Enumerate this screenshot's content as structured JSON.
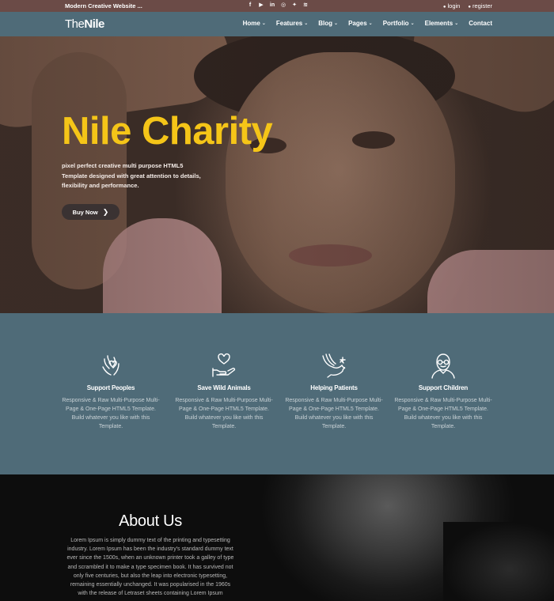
{
  "topbar": {
    "tagline": "Modern Creative Website ...",
    "socials": [
      {
        "icon": "facebook-icon",
        "glyph": "f"
      },
      {
        "icon": "youtube-icon",
        "glyph": "▶"
      },
      {
        "icon": "linkedin-icon",
        "glyph": "in"
      },
      {
        "icon": "dribbble-icon",
        "glyph": "◎"
      },
      {
        "icon": "twitter-icon",
        "glyph": "✦"
      },
      {
        "icon": "rss-icon",
        "glyph": "≋"
      }
    ],
    "login_label": "login",
    "register_label": "register"
  },
  "nav": {
    "logo_part1": "The",
    "logo_part2": "Nile",
    "items": [
      {
        "label": "Home",
        "dropdown": true
      },
      {
        "label": "Features",
        "dropdown": true
      },
      {
        "label": "Blog",
        "dropdown": true
      },
      {
        "label": "Pages",
        "dropdown": true
      },
      {
        "label": "Portfolio",
        "dropdown": true
      },
      {
        "label": "Elements",
        "dropdown": true
      },
      {
        "label": "Contact",
        "dropdown": false
      }
    ]
  },
  "hero": {
    "title": "Nile Charity",
    "text": "pixel perfect creative multi purpose HTML5 Template designed with great attention to details, flexibility and performance.",
    "button_label": "Buy Now",
    "title_color": "#f5c518"
  },
  "features": [
    {
      "icon": "hands-heart-icon",
      "title": "Support Peoples",
      "desc": "Responsive & Raw Multi-Purpose Multi-Page & One-Page HTML5 Template. Build whatever you like with this Template."
    },
    {
      "icon": "hand-heart-icon",
      "title": "Save Wild Animals",
      "desc": "Responsive & Raw Multi-Purpose Multi-Page & One-Page HTML5 Template. Build whatever you like with this Template."
    },
    {
      "icon": "dove-icon",
      "title": "Helping Patients",
      "desc": "Responsive & Raw Multi-Purpose Multi-Page & One-Page HTML5 Template. Build whatever you like with this Template."
    },
    {
      "icon": "elder-icon",
      "title": "Support Children",
      "desc": "Responsive & Raw Multi-Purpose Multi-Page & One-Page HTML5 Template. Build whatever you like with this Template."
    }
  ],
  "about": {
    "title": "About Us",
    "text": "Lorem Ipsum is simply dummy text of the printing and typesetting industry. Lorem Ipsum has been the industry's standard dummy text ever since the 1500s, when an unknown printer took a galley of type and scrambled it to make a type specimen book. It has survived not only five centuries, but also the leap into electronic typesetting, remaining essentially unchanged. It was popularised in the 1960s with the release of Letraset sheets containing Lorem Ipsum"
  },
  "colors": {
    "topbar": "#6b4b47",
    "navbar": "#4f6b78",
    "accent": "#f5c518"
  }
}
